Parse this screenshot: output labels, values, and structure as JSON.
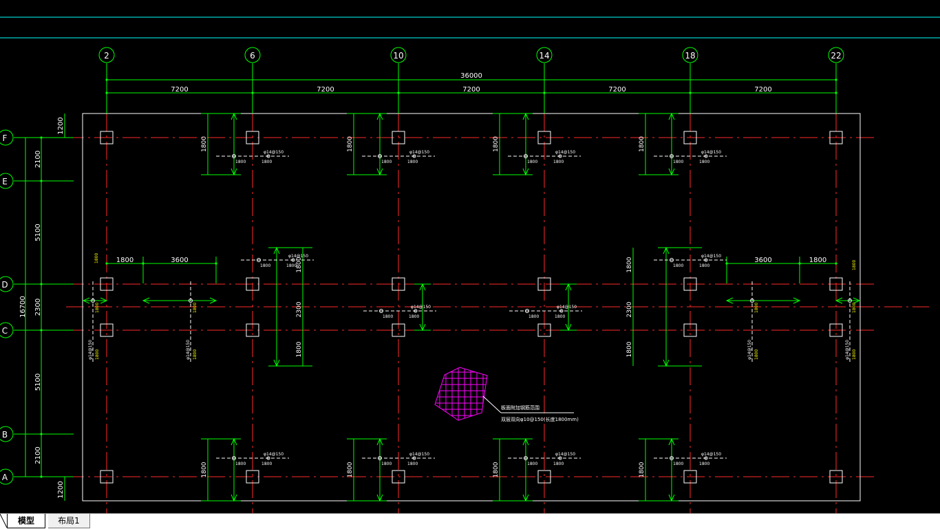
{
  "colors": {
    "background": "#000000",
    "dimension": "#00ff00",
    "axis_line": "#ff2a2a",
    "slab_outline": "#ffffff",
    "column": "#ffffff",
    "rebar_label": "#ffff00",
    "hatch": "#ff00ff",
    "guide": "#00ffff"
  },
  "grid_bubbles_top": [
    "2",
    "6",
    "10",
    "14",
    "18",
    "22"
  ],
  "grid_bubbles_left": [
    "F",
    "E",
    "D",
    "C",
    "B",
    "A"
  ],
  "top_dimensions": {
    "total": "36000",
    "spans": [
      "7200",
      "7200",
      "7200",
      "7200",
      "7200"
    ]
  },
  "left_dimensions": {
    "total": "16700",
    "spans": [
      "2100",
      "5100",
      "2300",
      "5100",
      "2100"
    ]
  },
  "edge_dimensions": {
    "top": "1200",
    "bottom": "1200"
  },
  "strip_dimensions": {
    "d1800": "1800",
    "d3600": "3600",
    "d2300": "2300"
  },
  "rebar_note": "φ14@150",
  "rebar_length": "1800",
  "hatch_note": {
    "line1": "板面附加钢筋范围",
    "line2": "双层双向φ10@150(长度1800mm)"
  },
  "tabs": {
    "model": "模型",
    "layout": "布局1"
  }
}
